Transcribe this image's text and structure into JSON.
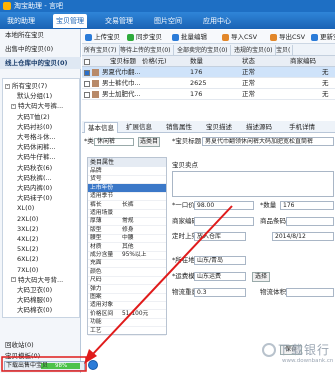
{
  "app": {
    "title": "淘宝助理 - 言吧",
    "nav_tabs": [
      "我的助理",
      "宝贝管理",
      "交易管理",
      "图片空间",
      "应用中心"
    ],
    "active_nav": 1
  },
  "sidebar": {
    "local_header": "本地所在宝贝",
    "items_top": [
      "出售中的宝贝(0)"
    ],
    "cloud_header": "线上仓库中的宝贝(0)",
    "tree": [
      {
        "label": "所有宝贝(7)",
        "level": 0,
        "toggle": "-"
      },
      {
        "label": "默认分组(1)",
        "level": 2
      },
      {
        "label": "特大码大号裤...",
        "level": 1,
        "toggle": "-"
      },
      {
        "label": "大码T恤(2)",
        "level": 2
      },
      {
        "label": "大码衬衫(0)",
        "level": 2
      },
      {
        "label": "大号格斗休...",
        "level": 2
      },
      {
        "label": "大码休闲裤...",
        "level": 2
      },
      {
        "label": "大码牛仔裤...",
        "level": 2
      },
      {
        "label": "大码秋衣(6)",
        "level": 2
      },
      {
        "label": "大码秋裤(...",
        "level": 2
      },
      {
        "label": "大码内裤(0)",
        "level": 2
      },
      {
        "label": "大码袜子(0)",
        "level": 2
      },
      {
        "label": "XL(0)",
        "level": 2
      },
      {
        "label": "2XL(0)",
        "level": 2
      },
      {
        "label": "3XL(2)",
        "level": 2
      },
      {
        "label": "4XL(2)",
        "level": 2
      },
      {
        "label": "5XL(2)",
        "level": 2
      },
      {
        "label": "6XL(2)",
        "level": 2
      },
      {
        "label": "7XL(0)",
        "level": 2
      },
      {
        "label": "特大码大号背...",
        "level": 1,
        "toggle": "-"
      },
      {
        "label": "大码卫衣(0)",
        "level": 2
      },
      {
        "label": "大码棉服(0)",
        "level": 2
      },
      {
        "label": "大码棉衣(0)",
        "level": 2
      }
    ],
    "bottom": [
      "回收站(0)",
      "宝贝模板(0)"
    ],
    "progress": {
      "label": "下载出售中宝贝",
      "percent": 98,
      "percent_label": "98%"
    }
  },
  "toolbar": {
    "buttons": [
      {
        "label": "上传宝贝",
        "icon": "upload-icon",
        "color": "#2a7bd8"
      },
      {
        "label": "同步宝贝",
        "icon": "sync-icon",
        "color": "#2eaa3c"
      },
      {
        "label": "批量编辑",
        "icon": "batch-edit-icon",
        "color": "#2a7bd8"
      },
      {
        "label": "导入CSV",
        "icon": "import-icon",
        "color": "#e2872a"
      },
      {
        "label": "导出CSV",
        "icon": "export-icon",
        "color": "#e2872a"
      },
      {
        "label": "更新宝",
        "icon": "refresh-icon",
        "color": "#2a7bd8"
      }
    ]
  },
  "subtabs": [
    "所有宝贝(7)",
    "等待上传的宝贝(0)",
    "全部卖完的宝贝(0)",
    "违规的宝贝(0)",
    "宝贝("
  ],
  "grid": {
    "headers": [
      "宝贝标题",
      "价格(元)",
      "数量",
      "状态",
      "商家编码"
    ],
    "rows": [
      {
        "title": "男夏代巾翻...",
        "price": "",
        "qty": "176",
        "status": "正常",
        "code": "无",
        "selected": true,
        "checked": true
      },
      {
        "title": "男士裤代巾...",
        "price": "",
        "qty": "2625",
        "status": "正常",
        "code": "无",
        "selected": false,
        "checked": false
      },
      {
        "title": "男士加肥代...",
        "price": "",
        "qty": "176",
        "status": "正常",
        "code": "无",
        "selected": false,
        "checked": false
      }
    ]
  },
  "detail_tabs": [
    "基本信息",
    "扩展信息",
    "销售属性",
    "宝贝描述",
    "描述源码",
    "手机详情"
  ],
  "active_detail_tab": 0,
  "attributes": {
    "category_label": "*类目",
    "category_value": "休闲裤",
    "select_button": "选类目",
    "table_header": "类目属性",
    "rows": [
      {
        "name": "品牌",
        "value": ""
      },
      {
        "name": "货号",
        "value": ""
      },
      {
        "name": "上市年份",
        "value": ""
      },
      {
        "name": "适用季节",
        "value": ""
      },
      {
        "name": "裤长",
        "value": "长裤"
      },
      {
        "name": "适用场景",
        "value": ""
      },
      {
        "name": "厚薄",
        "value": "常规"
      },
      {
        "name": "版型",
        "value": "修身"
      },
      {
        "name": "腰型",
        "value": "中腰"
      },
      {
        "name": "材质",
        "value": "其他"
      },
      {
        "name": "成分含量",
        "value": "95%以上"
      },
      {
        "name": "充面",
        "value": ""
      },
      {
        "name": "颜色",
        "value": ""
      },
      {
        "name": "尺码",
        "value": ""
      },
      {
        "name": "弹力",
        "value": ""
      },
      {
        "name": "图案",
        "value": ""
      },
      {
        "name": "适用对象",
        "value": ""
      },
      {
        "name": "价格区间",
        "value": "51-100元"
      },
      {
        "name": "功能",
        "value": ""
      },
      {
        "name": "工艺",
        "value": ""
      }
    ],
    "highlight_index": 2
  },
  "form": {
    "title_label": "*宝贝标题",
    "title_value": "男夏代巾翻领休闲裤大码加肥宽松直筒裤",
    "selling_point_label": "宝贝卖点",
    "price_label": "*一口价",
    "price_value": "98.00",
    "qty_label": "*数量",
    "qty_value": "176",
    "merchant_code_label": "商家编码",
    "barcode_label": "商品条码",
    "schedule_label": "定时上架",
    "schedule_value": "放入仓库",
    "date_value": "2014/8/12",
    "location_label": "*所在地",
    "location_value": "山东/青岛",
    "shipping_label": "*运费模板",
    "shipping_value": "山东运费",
    "shipping_button": "选择",
    "weight_label": "物流重量",
    "weight_value": "0.3",
    "volume_label": "物流体积",
    "save_button": "保存"
  },
  "watermark": {
    "text": "下载银行",
    "sub": "www.downbank.cn"
  }
}
